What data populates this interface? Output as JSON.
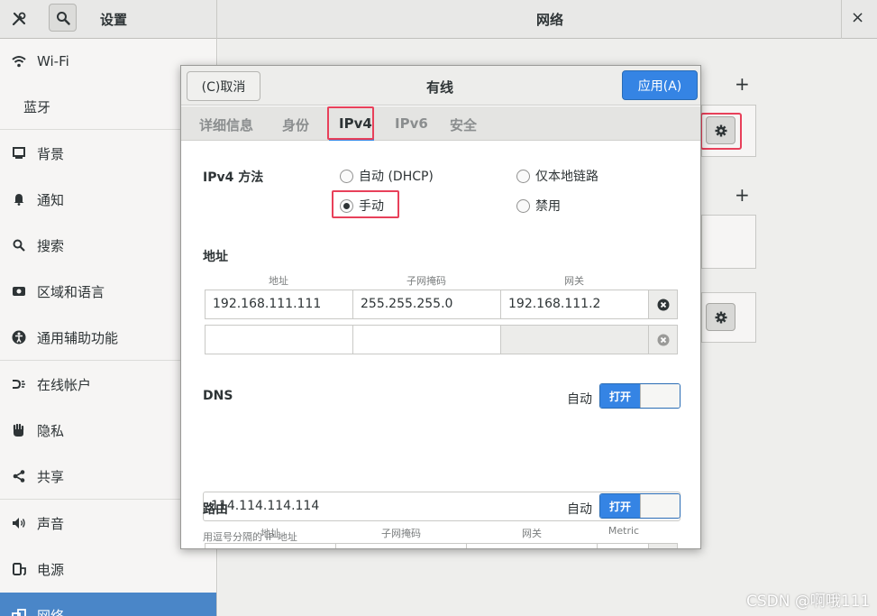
{
  "titlebar": {
    "settings_title": "设置",
    "network_title": "网络",
    "close": "×"
  },
  "sidebar": {
    "items": [
      {
        "label": "Wi-Fi",
        "icon": "wifi-icon"
      },
      {
        "label": "蓝牙",
        "icon": "bluetooth-icon"
      },
      {
        "label": "背景",
        "icon": "background-icon"
      },
      {
        "label": "通知",
        "icon": "bell-icon"
      },
      {
        "label": "搜索",
        "icon": "search-icon"
      },
      {
        "label": "区域和语言",
        "icon": "region-icon"
      },
      {
        "label": "通用辅助功能",
        "icon": "accessibility-icon"
      },
      {
        "label": "在线帐户",
        "icon": "online-accounts-icon"
      },
      {
        "label": "隐私",
        "icon": "hand-icon"
      },
      {
        "label": "共享",
        "icon": "share-icon"
      },
      {
        "label": "声音",
        "icon": "speaker-icon"
      },
      {
        "label": "电源",
        "icon": "power-icon"
      },
      {
        "label": "网络",
        "icon": "network-icon"
      }
    ],
    "selected": "网络"
  },
  "dialog": {
    "cancel_label": "(C)取消",
    "title": "有线",
    "apply_label": "应用(A)",
    "tabs": [
      "详细信息",
      "身份",
      "IPv4",
      "IPv6",
      "安全"
    ],
    "active_tab": "IPv4",
    "ipv4_method_label": "IPv4 方法",
    "methods": {
      "auto_dhcp": "自动 (DHCP)",
      "link_local": "仅本地链路",
      "manual": "手动",
      "disabled": "禁用",
      "selected": "手动"
    },
    "address_section_label": "地址",
    "address_columns": [
      "地址",
      "子网掩码",
      "网关"
    ],
    "address_rows": [
      {
        "address": "192.168.111.111",
        "netmask": "255.255.255.0",
        "gateway": "192.168.111.2"
      },
      {
        "address": "",
        "netmask": "",
        "gateway": ""
      }
    ],
    "dns_label": "DNS",
    "dns_auto_label": "自动",
    "dns_switch_on": "打开",
    "dns_value": "114.114.114.114",
    "dns_hint": "用逗号分隔的 IP 地址",
    "routes_label": "路由",
    "routes_auto_label": "自动",
    "routes_switch_on": "打开",
    "route_columns": [
      "地址",
      "子网掩码",
      "网关",
      "Metric"
    ]
  },
  "background": {
    "plus": "+"
  },
  "watermark": "CSDN @啊哦111",
  "colors": {
    "accent": "#3584e4",
    "highlight": "#e8405a",
    "selected_sidebar": "#4a86c8"
  }
}
